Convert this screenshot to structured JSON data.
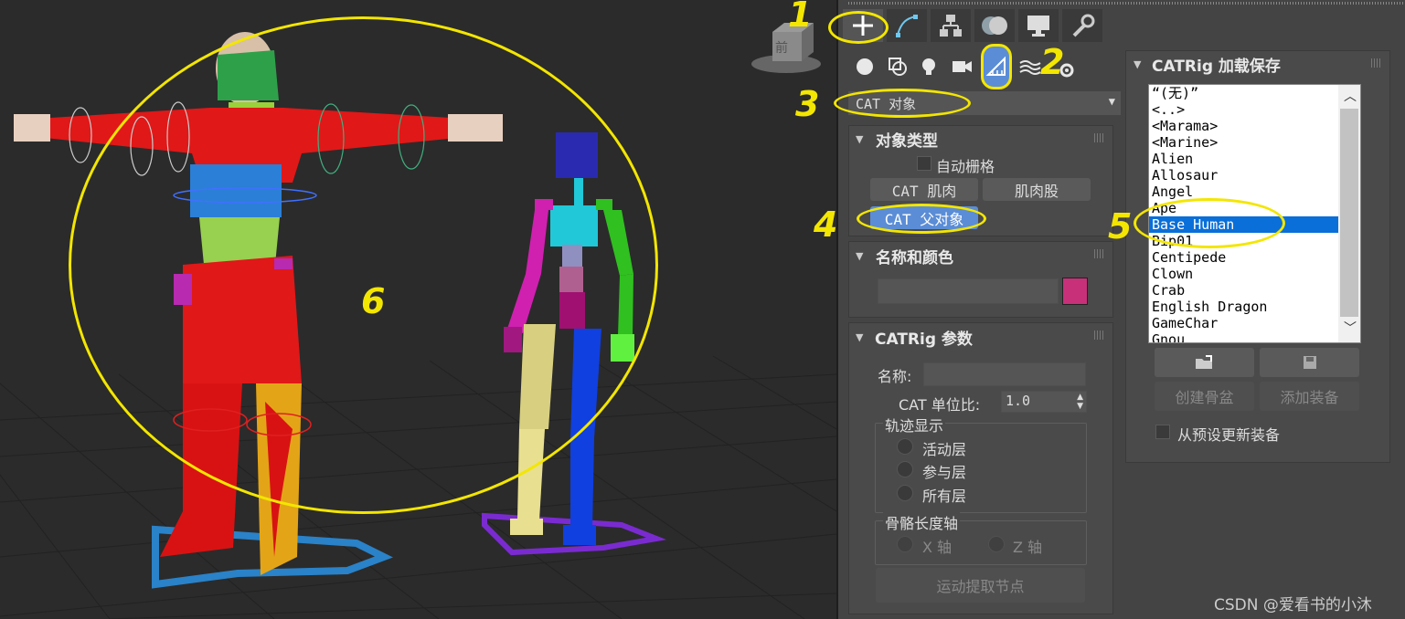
{
  "annotations": [
    "1",
    "2",
    "3",
    "4",
    "5",
    "6"
  ],
  "viewcube_label": "前",
  "command_tabs": [
    "create-icon",
    "modify-icon",
    "hierarchy-icon",
    "motion-icon",
    "display-icon",
    "utilities-icon"
  ],
  "create_categories": [
    "geometry-icon",
    "shapes-icon",
    "lights-icon",
    "cameras-icon",
    "helpers-icon",
    "spacewarps-icon",
    "systems-icon"
  ],
  "dropdown": {
    "value": "CAT 对象"
  },
  "object_type": {
    "title": "对象类型",
    "autogrid": "自动栅格",
    "buttons": [
      "CAT 肌肉",
      "肌肉股",
      "CAT 父对象"
    ]
  },
  "name_color": {
    "title": "名称和颜色",
    "color": "#c8307a"
  },
  "catrig_params": {
    "title": "CATRig 参数",
    "name_label": "名称:",
    "unit_label": "CAT 单位比:",
    "unit_value": "1.0",
    "trajectory_group": "轨迹显示",
    "trajectory_options": [
      "活动层",
      "参与层",
      "所有层"
    ],
    "bone_axis_group": "骨骼长度轴",
    "bone_axis_options": [
      "X 轴",
      "Z 轴"
    ],
    "extract_button": "运动提取节点"
  },
  "catrig_load_save": {
    "title": "CATRig 加载保存",
    "items": [
      "“(无)”",
      "<..>",
      "<Marama>",
      "<Marine>",
      "Alien",
      "Allosaur",
      "Angel",
      "Ape",
      "Base Human",
      "Bip01",
      "Centipede",
      "Clown",
      "Crab",
      "English Dragon",
      "GameChar",
      "Gnou"
    ],
    "selected": "Base Human",
    "create_pelvis": "创建骨盆",
    "add_rig": "添加装备",
    "update_from_preset": "从预设更新装备"
  },
  "watermark": "CSDN @爱看书的小沐"
}
